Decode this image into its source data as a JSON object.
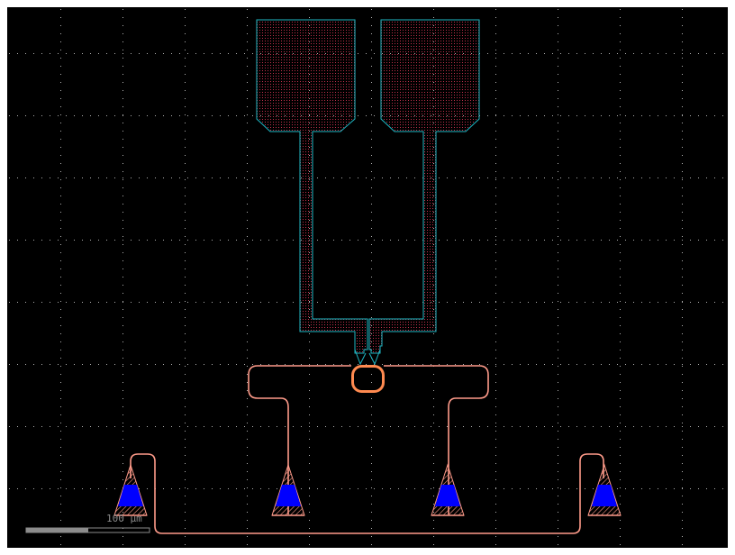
{
  "view": {
    "background": "#000000",
    "frame_color": "#ffffff",
    "grid_color": "#b0b0b0"
  },
  "colors": {
    "metal_outline": "#1fb7c4",
    "metal_fill_dot": "#c0304a",
    "waveguide": "#ff9b8a",
    "ring": "#ff8a50",
    "coupler_fill": "#0000ff",
    "coupler_hatch": "#ff9b8a",
    "scalebar_fill": "#8c8c8c"
  },
  "scale_bar": {
    "label": "100 µm"
  },
  "layout": {
    "bond_pads": [
      "pad-left",
      "pad-right"
    ],
    "grating_couplers": [
      "gc-1",
      "gc-2",
      "gc-3",
      "gc-4"
    ]
  }
}
